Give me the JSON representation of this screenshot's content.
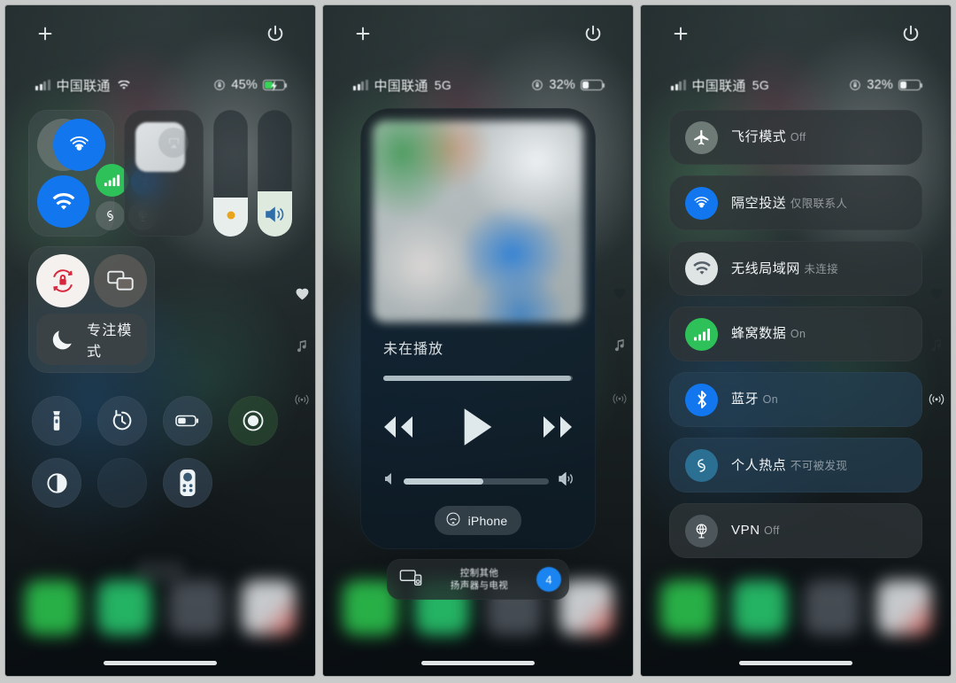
{
  "panels": [
    {
      "name": "control-center-main",
      "topbar": {
        "add_icon": "plus-icon",
        "power_icon": "power-icon"
      },
      "status": {
        "carrier": "中国联通",
        "network": "",
        "wifi_icon": "wifi-icon",
        "lock_icon": "rotation-lock-icon",
        "battery_pct": "45%",
        "battery_fill": 45,
        "charging": true
      },
      "connectivity": {
        "airplane": {
          "label": "飞行模式",
          "icon": "airplane-icon",
          "state": "off"
        },
        "airdrop": {
          "label": "隔空投送",
          "icon": "airdrop-icon",
          "state": "on"
        },
        "wifi": {
          "label": "无线局域网",
          "icon": "wifi-icon",
          "state": "on"
        },
        "cellular": {
          "label": "蜂窝数据",
          "icon": "cellular-icon",
          "state": "on"
        },
        "bluetooth": {
          "label": "蓝牙",
          "icon": "bluetooth-icon",
          "state": "on"
        },
        "hotspot": {
          "label": "个人热点",
          "icon": "hotspot-icon",
          "state": "off"
        },
        "vpn": {
          "label": "VPN",
          "icon": "vpn-icon",
          "state": "off"
        }
      },
      "rotation_lock": {
        "icon": "rotation-lock-icon",
        "state": "on"
      },
      "screen_mirroring": {
        "icon": "screen-mirroring-icon",
        "state": "off"
      },
      "focus": {
        "label": "专注模式",
        "icon": "moon-icon"
      },
      "brightness": {
        "icon": "brightness-icon",
        "value": 31
      },
      "volume": {
        "icon": "volume-icon",
        "value": 36
      },
      "toggles": [
        {
          "name": "flashlight",
          "icon": "flashlight-icon"
        },
        {
          "name": "timer",
          "icon": "timer-icon"
        },
        {
          "name": "low-power-mode",
          "icon": "battery-icon"
        },
        {
          "name": "screen-record",
          "icon": "record-icon",
          "accent": "green"
        },
        {
          "name": "dark-mode",
          "icon": "dark-mode-icon"
        },
        {
          "name": "empty-slot",
          "icon": ""
        },
        {
          "name": "apple-tv-remote",
          "icon": "remote-icon"
        }
      ]
    },
    {
      "name": "now-playing",
      "topbar": {
        "add_icon": "plus-icon",
        "power_icon": "power-icon"
      },
      "status": {
        "carrier": "中国联通",
        "network": "5G",
        "battery_pct": "32%",
        "battery_fill": 32,
        "charging": false
      },
      "player": {
        "title": "未在播放",
        "elapsed": "",
        "remaining": "",
        "progress": 99,
        "rewind_icon": "rewind-icon",
        "play_icon": "play-icon",
        "forward_icon": "fast-forward-icon",
        "volume": 55,
        "output_device": "iPhone",
        "output_icon": "airplay-icon"
      },
      "speakers": {
        "line1": "控制其他",
        "line2": "扬声器与电视",
        "count": "4",
        "icon": "tv-speaker-icon"
      }
    },
    {
      "name": "connectivity-expanded",
      "topbar": {
        "add_icon": "plus-icon",
        "power_icon": "power-icon"
      },
      "status": {
        "carrier": "中国联通",
        "network": "5G",
        "battery_pct": "32%",
        "battery_fill": 32,
        "charging": false
      },
      "rows": [
        {
          "title": "飞行模式",
          "subtitle": "Off",
          "icon": "airplane-icon",
          "icon_color": "#6e7a76",
          "active": false
        },
        {
          "title": "隔空投送",
          "subtitle": "仅限联系人",
          "icon": "airdrop-icon",
          "icon_color": "#1277ef",
          "active": false
        },
        {
          "title": "无线局域网",
          "subtitle": "未连接",
          "icon": "wifi-icon",
          "icon_color": "#d9dedf",
          "active": false
        },
        {
          "title": "蜂窝数据",
          "subtitle": "On",
          "icon": "cellular-icon",
          "icon_color": "#2ec159",
          "active": false
        },
        {
          "title": "蓝牙",
          "subtitle": "On",
          "icon": "bluetooth-icon",
          "icon_color": "#1277ef",
          "active": true
        },
        {
          "title": "个人热点",
          "subtitle": "不可被发现",
          "icon": "hotspot-icon",
          "icon_color": "#2b6f93",
          "active": true
        },
        {
          "title": "VPN",
          "subtitle": "Off",
          "icon": "vpn-icon",
          "icon_color": "#4d565a",
          "active": false
        }
      ]
    }
  ],
  "edge_icons": [
    "heart-icon",
    "music-note-icon",
    "connectivity-icon"
  ],
  "colors": {
    "accent_blue": "#1277ef",
    "accent_green": "#2ec159",
    "badge_blue": "#1a84f0",
    "panel_gap": "#c9cbcb"
  }
}
